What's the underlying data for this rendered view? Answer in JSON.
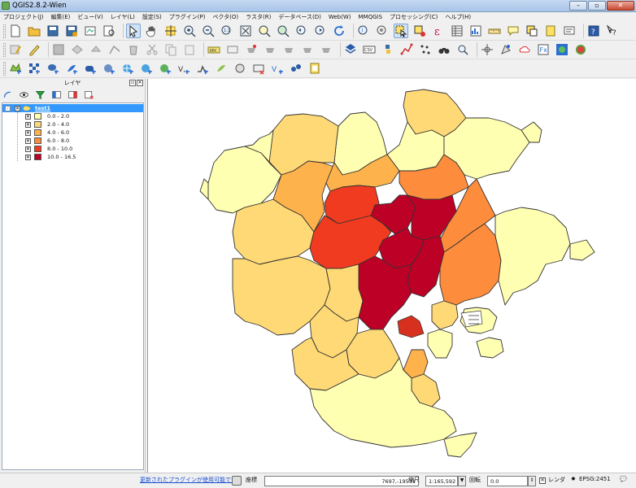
{
  "window": {
    "title": "QGIS2.8.2-Wien"
  },
  "menu": [
    "プロジェクト(J)",
    "編集(E)",
    "ビュー(V)",
    "レイヤ(L)",
    "設定(S)",
    "プラグイン(P)",
    "ベクタ(O)",
    "ラスタ(R)",
    "データベース(D)",
    "Web(W)",
    "MMQGIS",
    "プロセッシング(C)",
    "ヘルプ(H)"
  ],
  "layers_panel": {
    "title": "レイヤ",
    "layer": {
      "name": "test1",
      "checked": true,
      "classes": [
        {
          "label": "0.0 - 2.0",
          "color": "#ffffb2"
        },
        {
          "label": "2.0 - 4.0",
          "color": "#fed976"
        },
        {
          "label": "4.0 - 6.0",
          "color": "#feb24c"
        },
        {
          "label": "6.0 - 8.0",
          "color": "#fd8d3c"
        },
        {
          "label": "8.0 - 10.0",
          "color": "#f03b20"
        },
        {
          "label": "10.0 - 16.5",
          "color": "#bd0026"
        }
      ]
    }
  },
  "map": {
    "region_classes": [
      1,
      0,
      0,
      0,
      0,
      1,
      0,
      1,
      1,
      2,
      2,
      3,
      3,
      4,
      4,
      5,
      5,
      5,
      5,
      5,
      3,
      1,
      1,
      1,
      1,
      2,
      0,
      1,
      0,
      0,
      0,
      1,
      0,
      0,
      0,
      0,
      0
    ]
  },
  "statusbar": {
    "message": "更新されたプラグインが使用可能です",
    "coord_label": "座標",
    "coord_value": "7697,-19531",
    "scale_label": "縮尺",
    "scale_value": "1:165,592",
    "rotation_label": "回転",
    "rotation_value": "0.0",
    "render_label": "レンダ",
    "render_checked": true,
    "crs": "EPSG:2451"
  }
}
